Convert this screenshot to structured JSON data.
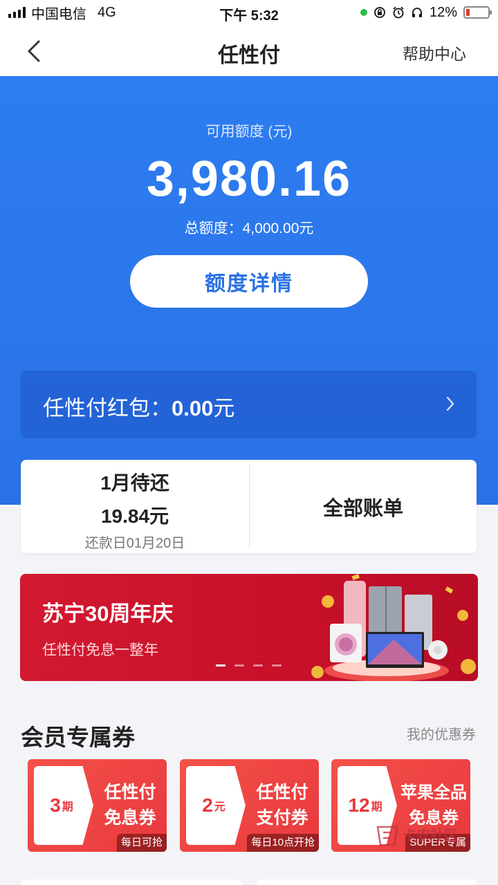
{
  "status_bar": {
    "carrier": "中国电信",
    "network": "4G",
    "time": "下午 5:32",
    "battery": "12%"
  },
  "nav": {
    "title": "任性付",
    "help": "帮助中心"
  },
  "credit": {
    "available_label": "可用额度 (元)",
    "available_amount": "3,980.16",
    "total_line": "总额度：4,000.00元",
    "detail_button": "额度详情"
  },
  "red_packet": {
    "label": "任性付红包：",
    "value": "0.00",
    "unit": "元"
  },
  "bill": {
    "month_label": "1月待还",
    "amount": "19.84元",
    "due_date": "还款日01月20日",
    "all_bills": "全部账单"
  },
  "banner": {
    "title": "苏宁30周年庆",
    "subtitle": "任性付免息一整年"
  },
  "coupons_section": {
    "title": "会员专属券",
    "my_coupons": "我的优惠券",
    "items": [
      {
        "num": "3",
        "unit": "期",
        "line1": "任性付",
        "line2": "免息券",
        "tag": "每日可抢"
      },
      {
        "num": "2",
        "unit": "元",
        "line1": "任性付",
        "line2": "支付券",
        "tag": "每日10点开抢"
      },
      {
        "num": "12",
        "unit": "期",
        "line1": "苹果全品",
        "line2": "免息券",
        "tag": "SUPER专属"
      }
    ]
  },
  "watermark": "卡农社区",
  "colors": {
    "brand_blue": "#2a71e6",
    "banner_red": "#c8102a",
    "coupon_red": "#e8383d"
  }
}
